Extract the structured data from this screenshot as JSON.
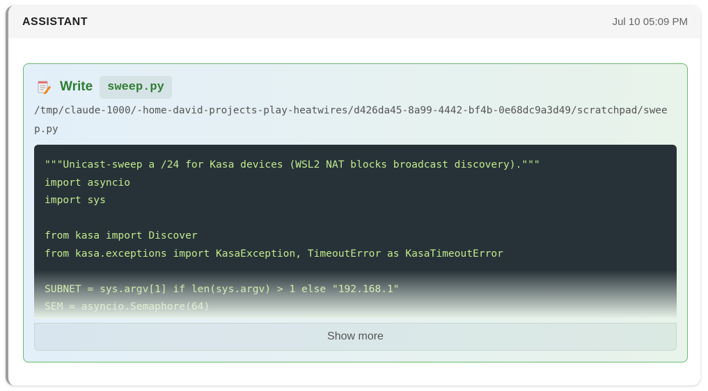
{
  "message": {
    "role": "ASSISTANT",
    "timestamp": "Jul 10 05:09 PM"
  },
  "tool_call": {
    "tool": "Write",
    "icon": "memo-icon",
    "filename": "sweep.py",
    "path": "/tmp/claude-1000/-home-david-projects-play-heatwires/d426da45-8a99-4442-bf4b-0e68dc9a3d49/scratchpad/sweep.py",
    "code": "\"\"\"Unicast-sweep a /24 for Kasa devices (WSL2 NAT blocks broadcast discovery).\"\"\"\nimport asyncio\nimport sys\n\nfrom kasa import Discover\nfrom kasa.exceptions import KasaException, TimeoutError as KasaTimeoutError\n\nSUBNET = sys.argv[1] if len(sys.argv) > 1 else \"192.168.1\"\nSEM = asyncio.Semaphore(64)",
    "show_more_label": "Show more"
  },
  "colors": {
    "tool_accent": "#2e7d32",
    "tool_border": "#66bb6a",
    "code_background": "#263238",
    "code_text": "#c3e88d"
  }
}
